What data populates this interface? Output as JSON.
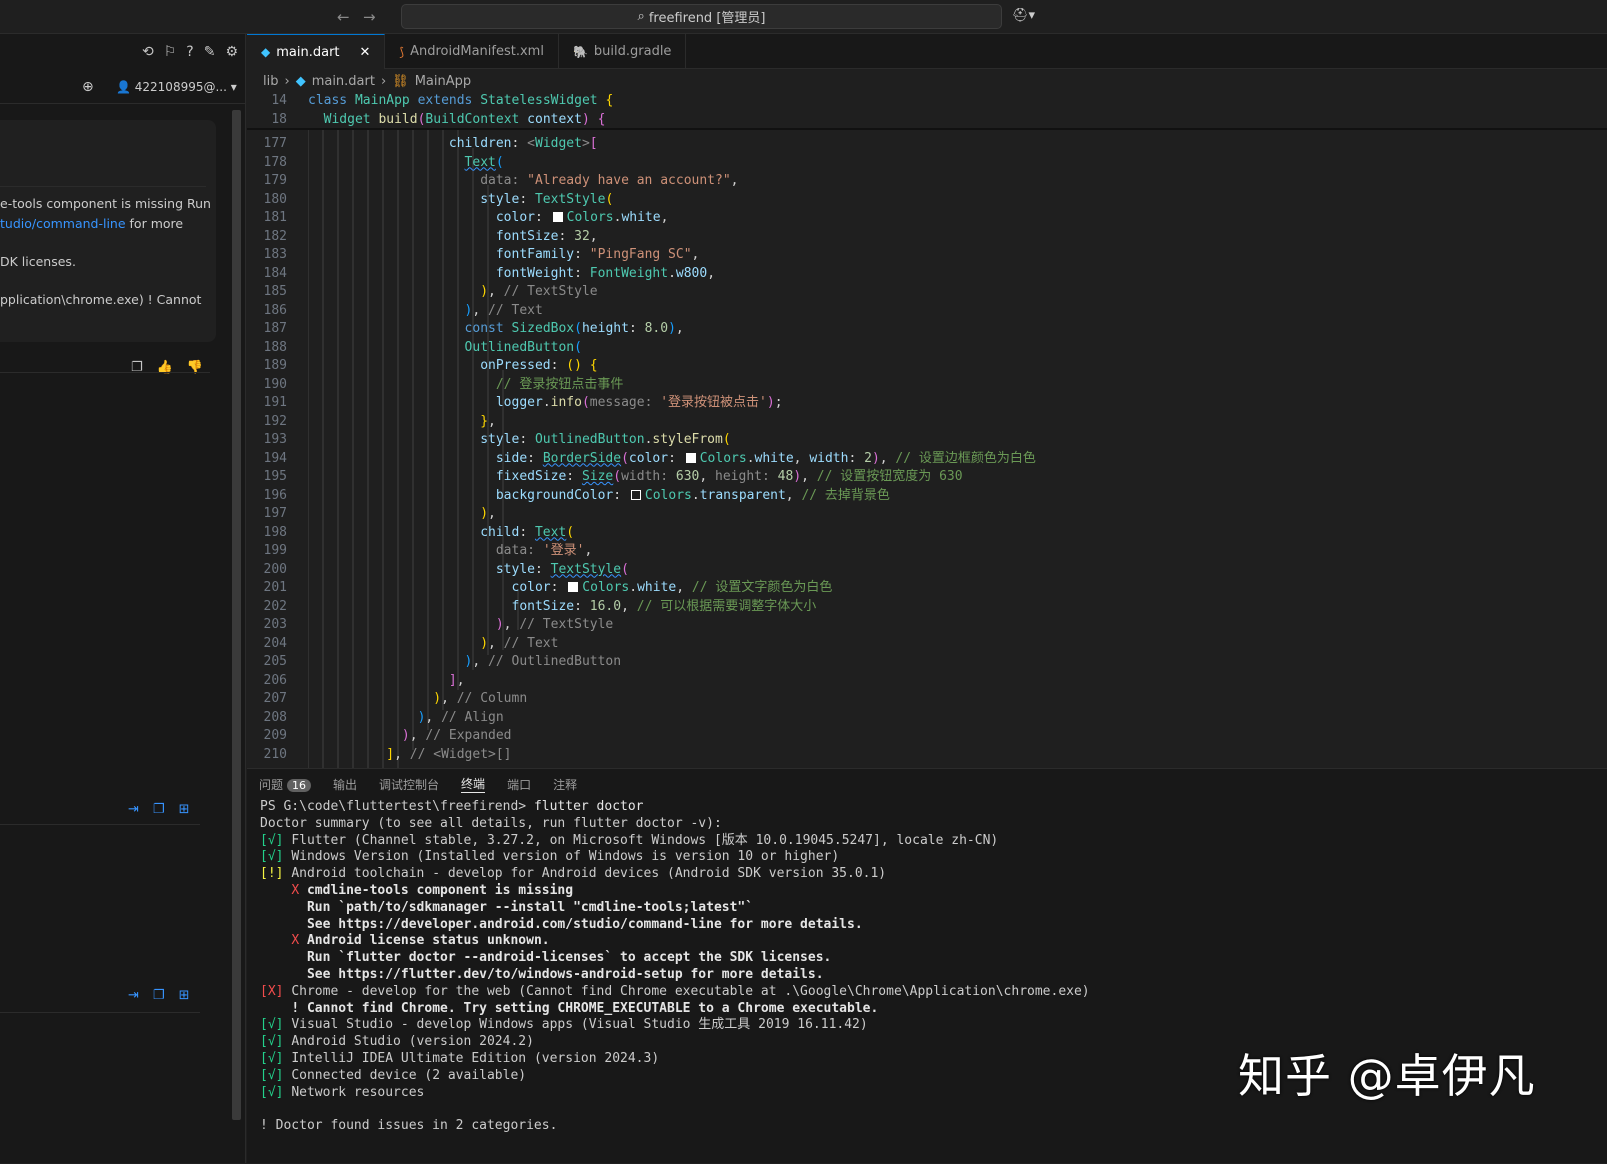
{
  "titlebar": {
    "back": "←",
    "forward": "→",
    "search_text": "freefirend [管理员]",
    "copilot": "⛑▾"
  },
  "left_panel": {
    "account": "422108995@...",
    "chat_lines": [
      {
        "text": "e-tools component is missing Run",
        "link": ""
      },
      {
        "text": " for more",
        "link": "tudio/command-line"
      },
      {
        "text": "DK licenses.",
        "link": ""
      },
      {
        "text": "pplication\\chrome.exe) ! Cannot",
        "link": ""
      }
    ]
  },
  "tabs": [
    {
      "label": "main.dart",
      "active": true,
      "close": "✕"
    },
    {
      "label": "AndroidManifest.xml",
      "active": false,
      "close": ""
    },
    {
      "label": "build.gradle",
      "active": false,
      "close": ""
    }
  ],
  "breadcrumb": {
    "a": "lib",
    "b": "main.dart",
    "c": "MainApp"
  },
  "editor": {
    "sticky_14": "14",
    "sticky_18": "18",
    "line_numbers": [
      "177",
      "178",
      "179",
      "180",
      "181",
      "182",
      "183",
      "184",
      "185",
      "186",
      "187",
      "188",
      "189",
      "190",
      "191",
      "192",
      "193",
      "194",
      "195",
      "196",
      "197",
      "198",
      "199",
      "200",
      "201",
      "202",
      "203",
      "204",
      "205",
      "206",
      "207",
      "208",
      "209",
      "210"
    ]
  },
  "panel": {
    "tabs": [
      "问题",
      "输出",
      "调试控制台",
      "终端",
      "端口",
      "注释"
    ],
    "problem_count": "16"
  },
  "terminal": {
    "prompt": "PS G:\\code\\fluttertest\\freefirend> ",
    "command": "flutter doctor",
    "lines": [
      "Doctor summary (to see all details, run flutter doctor -v):",
      "Flutter (Channel stable, 3.27.2, on Microsoft Windows [版本 10.0.19045.5247], locale zh-CN)",
      "Windows Version (Installed version of Windows is version 10 or higher)",
      "Android toolchain - develop for Android devices (Android SDK version 35.0.1)",
      "cmdline-tools component is missing",
      "Run `path/to/sdkmanager --install \"cmdline-tools;latest\"`",
      "See https://developer.android.com/studio/command-line for more details.",
      "Android license status unknown.",
      "Run `flutter doctor --android-licenses` to accept the SDK licenses.",
      "See https://flutter.dev/to/windows-android-setup for more details.",
      "Chrome - develop for the web (Cannot find Chrome executable at .\\Google\\Chrome\\Application\\chrome.exe)",
      "! Cannot find Chrome. Try setting CHROME_EXECUTABLE to a Chrome executable.",
      "Visual Studio - develop Windows apps (Visual Studio 生成工具 2019 16.11.42)",
      "Android Studio (version 2024.2)",
      "IntelliJ IDEA Ultimate Edition (version 2024.3)",
      "Connected device (2 available)",
      "Network resources",
      "! Doctor found issues in 2 categories."
    ],
    "ok": "[√]",
    "warn": "[!]",
    "err": "[X]",
    "x": "X"
  },
  "watermark": "知乎 @卓伊凡"
}
